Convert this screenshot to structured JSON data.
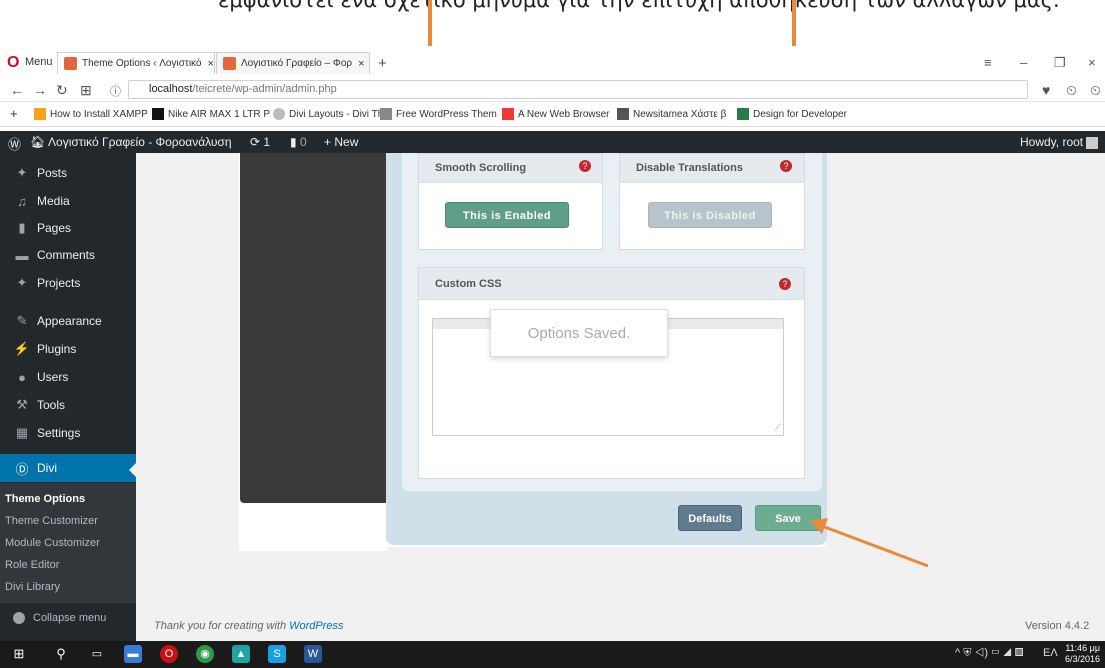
{
  "caption": "εμφανίστει ένα σχετικό μήνυμα για την επιτυχή αποθήκευση των αλλαγών μας.",
  "browser": {
    "menu_label": "Menu",
    "tabs": [
      {
        "title": "Theme Options ‹ Λογιστικό",
        "close": "×"
      },
      {
        "title": "Λογιστικό Γραφείο – Φορ",
        "close": "×"
      }
    ],
    "new_tab": "+",
    "url_host": "localhost",
    "url_path": "/teicrete/wp-admin/admin.php",
    "bookmarks": [
      {
        "label": "How to Install XAMPP",
        "icon": "xampp-icon",
        "color": "#f6a21b"
      },
      {
        "label": "Nike AIR MAX 1 LTR P",
        "icon": "nike-icon",
        "color": "#111111"
      },
      {
        "label": "Divi Layouts - Divi Th",
        "icon": "divi-icon",
        "color": "#cccccc"
      },
      {
        "label": "Free WordPress Them",
        "icon": "page-icon",
        "color": "#888888"
      },
      {
        "label": "A New Web Browser",
        "icon": "vivaldi-icon",
        "color": "#ef3939"
      },
      {
        "label": "Newsitamea Χάστε β",
        "icon": "house-icon",
        "color": "#555555"
      },
      {
        "label": "Design for Developer",
        "icon": "monitor-icon",
        "color": "#2a7a4a"
      }
    ]
  },
  "adminbar": {
    "site_name": "Λογιστικό Γραφείο - Φοροανάλυση",
    "updates": "1",
    "comments": "0",
    "new_label": "New",
    "greeting": "Howdy, root"
  },
  "sidebar": {
    "items": [
      {
        "label": "Posts",
        "icon": "pin-icon"
      },
      {
        "label": "Media",
        "icon": "media-icon"
      },
      {
        "label": "Pages",
        "icon": "pages-icon"
      },
      {
        "label": "Comments",
        "icon": "comment-icon"
      },
      {
        "label": "Projects",
        "icon": "pin-icon"
      },
      {
        "label": "Appearance",
        "icon": "brush-icon"
      },
      {
        "label": "Plugins",
        "icon": "plug-icon"
      },
      {
        "label": "Users",
        "icon": "user-icon"
      },
      {
        "label": "Tools",
        "icon": "wrench-icon"
      },
      {
        "label": "Settings",
        "icon": "settings-icon"
      },
      {
        "label": "Divi",
        "icon": "divi-icon"
      }
    ],
    "submenu": [
      "Theme Options",
      "Theme Customizer",
      "Module Customizer",
      "Role Editor",
      "Divi Library"
    ],
    "collapse": "Collapse menu"
  },
  "options": {
    "smooth_scrolling": {
      "title": "Smooth Scrolling",
      "state": "This is Enabled"
    },
    "disable_translations": {
      "title": "Disable Translations",
      "state": "This is Disabled"
    },
    "custom_css": {
      "title": "Custom CSS"
    },
    "help": "?",
    "toast": "Options Saved.",
    "defaults_button": "Defaults",
    "save_button": "Save"
  },
  "footer": {
    "thanks": "Thank you for creating with ",
    "wordpress": "WordPress",
    "version": "Version 4.4.2"
  },
  "taskbar": {
    "language": "ΕΛ",
    "time": "11:46 μμ",
    "date": "6/3/2016"
  },
  "colors": {
    "accent": "#0073aa",
    "annotation": "#e98a3a",
    "save": "#6cad92"
  }
}
